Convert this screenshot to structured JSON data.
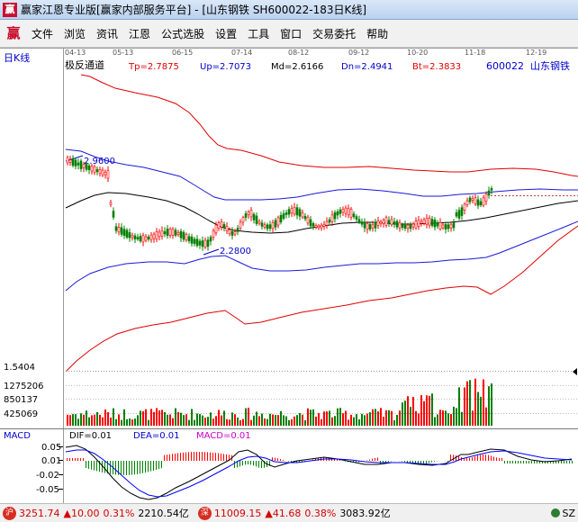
{
  "window": {
    "title": "赢家江恩专业版[赢家内部服务平台] - [山东钢铁  SH600022-183日K线]"
  },
  "menu": {
    "items": [
      "文件",
      "浏览",
      "资讯",
      "江恩",
      "公式选股",
      "设置",
      "工具",
      "窗口",
      "交易委托",
      "帮助"
    ]
  },
  "chart": {
    "period_label": "日K线",
    "indicator_name": "极反通道",
    "stock_code": "600022",
    "stock_name": "山东钢铁",
    "values": {
      "tp": "Tp=2.7875",
      "up": "Up=2.7073",
      "md": "Md=2.6166",
      "dn": "Dn=2.4941",
      "bt": "Bt=2.3833"
    },
    "dates": [
      "04-13",
      "05-13",
      "06-15",
      "07-14",
      "08-12",
      "09-12",
      "10-20",
      "11-18",
      "12-19"
    ],
    "price_high_label": "2.9600",
    "price_low_label": "2.2800",
    "volume_labels": [
      "1.5404",
      "1275206",
      "850137",
      "425069"
    ],
    "macd": {
      "name": "MACD",
      "dif": "DIF=0.01",
      "dea": "DEA=0.01",
      "macd": "MACD=0.01",
      "ticks": [
        "0.05",
        "0.01",
        "-0.02",
        "-0.05"
      ]
    },
    "colors": {
      "up": "#ff0000",
      "down": "#008000",
      "upper_channel": "#e00000",
      "mid_channel": "#1a1ad8",
      "center_line": "#000000",
      "volume_up": "#ff0000",
      "volume_down": "#008000",
      "dif_line": "#000000",
      "dea_line": "#0000ff"
    }
  },
  "status": {
    "sh_index": "3251.74",
    "sh_change": "▲10.00",
    "sh_pct": "0.31%",
    "sh_amount": "2210.54亿",
    "sz_index": "11009.15",
    "sz_change": "▲41.68",
    "sz_pct": "0.38%",
    "sz_amount": "3083.92亿",
    "sh_icon_label": "沪",
    "sz_icon_label": "深",
    "right_label": "SZ"
  }
}
